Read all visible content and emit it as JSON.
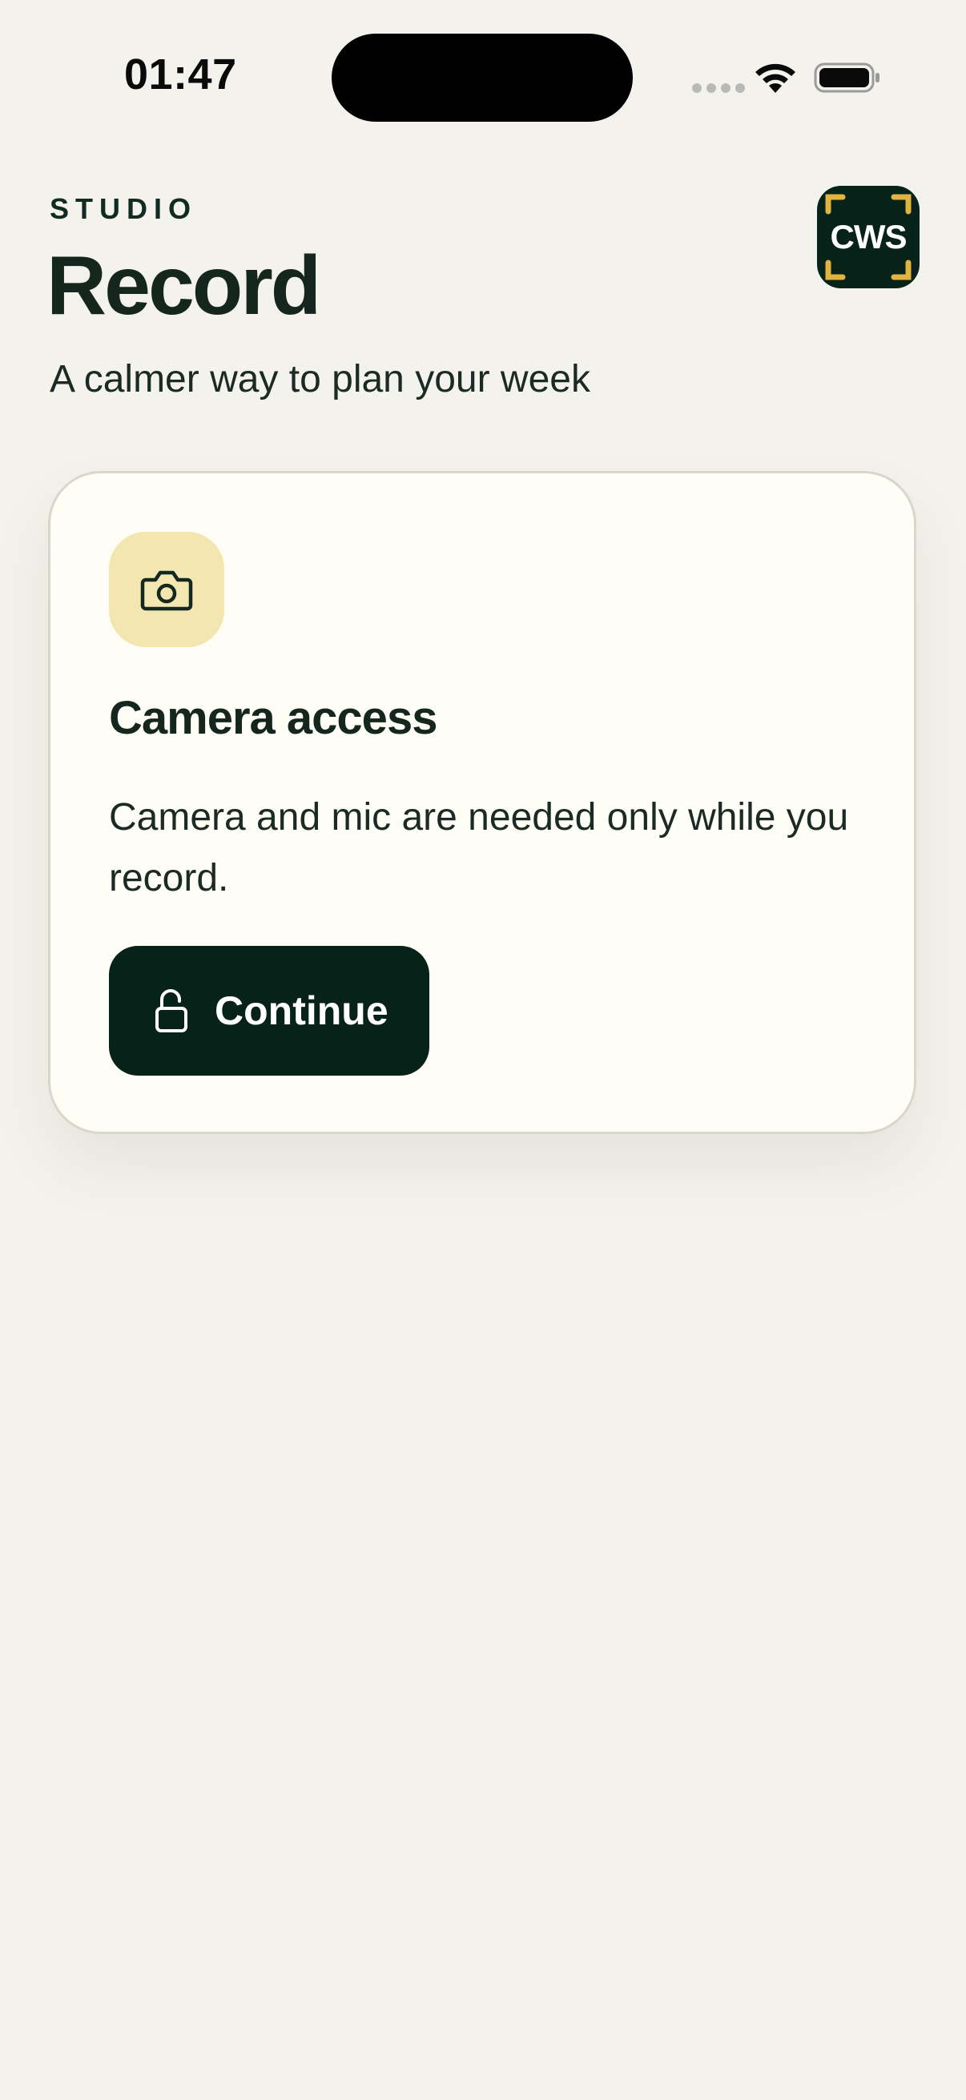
{
  "status_bar": {
    "time": "01:47",
    "icons": [
      "signal-dots-icon",
      "wifi-icon",
      "battery-icon"
    ]
  },
  "header": {
    "eyebrow": "STUDIO",
    "title": "Record",
    "subtitle": "A calmer way to plan your week",
    "badge_text": "CWS"
  },
  "permission_card": {
    "icon": "camera-icon",
    "title": "Camera access",
    "body": "Camera and mic are needed only while you record.",
    "button_icon": "unlock-icon",
    "button_label": "Continue"
  },
  "colors": {
    "background": "#f4f2ec",
    "card": "#fefdf6",
    "primary_dark": "#062219",
    "icon_tile": "#f4e6b0",
    "accent_gold": "#e3b341"
  }
}
